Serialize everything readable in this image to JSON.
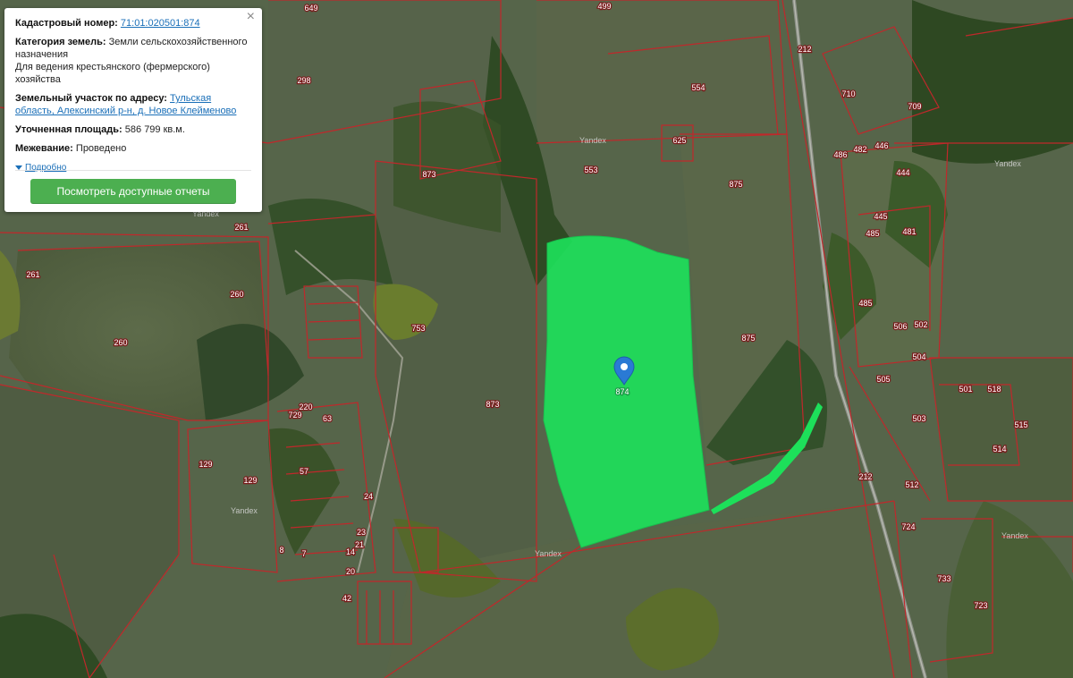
{
  "popup": {
    "cad_label": "Кадастровый номер:",
    "cad_number": "71:01:020501:874",
    "category_label": "Категория земель:",
    "category_value": "Земли сельскохозяйственного назначения",
    "usage": "Для ведения крестьянского (фермерского) хозяйства",
    "address_label": "Земельный участок по адресу:",
    "address_value": "Тульская область, Алексинский р-н, д. Новое Клейменово",
    "area_label": "Уточненная площадь:",
    "area_value": "586 799 кв.м.",
    "survey_label": "Межевание:",
    "survey_value": "Проведено",
    "more_label": "Подробно",
    "close_glyph": "×",
    "reports_button": "Посмотреть доступные отчеты"
  },
  "map": {
    "marker_label": "874",
    "attribution": "Yandex",
    "parcel_labels": [
      "649",
      "499",
      "212",
      "554",
      "710",
      "709",
      "298",
      "553",
      "625",
      "486",
      "482",
      "446",
      "444",
      "873",
      "875",
      "261",
      "445",
      "485",
      "481",
      "260",
      "261",
      "485",
      "753",
      "502",
      "506",
      "875",
      "504",
      "505",
      "501",
      "518",
      "503",
      "260",
      "873",
      "220",
      "63",
      "515",
      "729",
      "514",
      "129",
      "57",
      "129",
      "212",
      "512",
      "24",
      "23",
      "21",
      "8",
      "14",
      "20",
      "7",
      "724",
      "733",
      "42",
      "723"
    ],
    "colors": {
      "parcel_border": "#c0282b",
      "highlight_fill": "#1de05a",
      "marker": "#2a7ad4",
      "button": "#4caf50"
    }
  }
}
